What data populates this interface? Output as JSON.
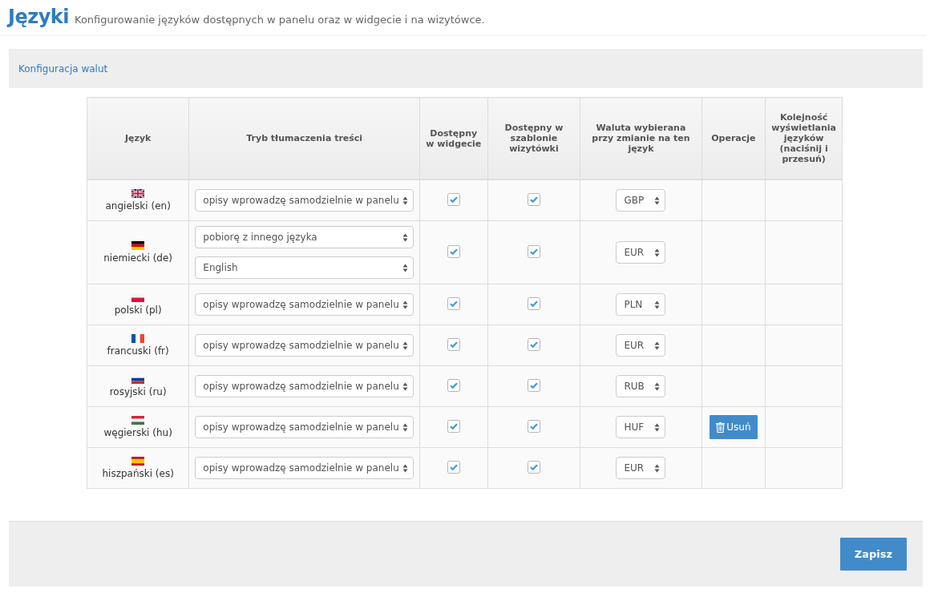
{
  "header": {
    "title": "Języki",
    "subtitle": "Konfigurowanie języków dostępnych w panelu oraz w widgecie i na wizytówce."
  },
  "config_link": "Konfiguracja walut",
  "table": {
    "columns": [
      "Język",
      "Tryb tłumaczenia treści",
      "Dostępny w widgecie",
      "Dostępny w szablonie wizytówki",
      "Waluta wybierana przy zmianie na ten język",
      "Operacje",
      "Kolejność wyświetlania języków (naciśnij i przesuń)"
    ],
    "rows": [
      {
        "kind": "gb",
        "language": "angielski (en)",
        "modes": [
          "opisy wprowadzę samodzielnie w panelu"
        ],
        "widget": true,
        "template": true,
        "currency": "GBP"
      },
      {
        "kind": "de",
        "language": "niemiecki (de)",
        "modes": [
          "pobiorę z innego języka",
          "English"
        ],
        "widget": true,
        "template": true,
        "currency": "EUR"
      },
      {
        "kind": "pl",
        "language": "polski (pl)",
        "modes": [
          "opisy wprowadzę samodzielnie w panelu"
        ],
        "widget": true,
        "template": true,
        "currency": "PLN"
      },
      {
        "kind": "fr",
        "language": "francuski (fr)",
        "modes": [
          "opisy wprowadzę samodzielnie w panelu"
        ],
        "widget": true,
        "template": true,
        "currency": "EUR"
      },
      {
        "kind": "ru",
        "language": "rosyjski (ru)",
        "modes": [
          "opisy wprowadzę samodzielnie w panelu"
        ],
        "widget": true,
        "template": true,
        "currency": "RUB"
      },
      {
        "kind": "hu",
        "language": "węgierski (hu)",
        "modes": [
          "opisy wprowadzę samodzielnie w panelu"
        ],
        "widget": true,
        "template": true,
        "currency": "HUF",
        "operation": "Usuń"
      },
      {
        "kind": "es",
        "language": "hiszpański (es)",
        "modes": [
          "opisy wprowadzę samodzielnie w panelu"
        ],
        "widget": true,
        "template": true,
        "currency": "EUR"
      }
    ]
  },
  "save_button": "Zapisz"
}
